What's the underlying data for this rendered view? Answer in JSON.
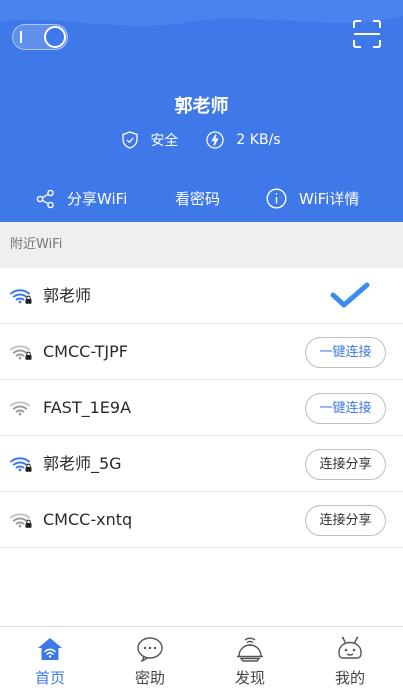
{
  "header": {
    "title": "郭老师",
    "security_label": "安全",
    "speed_label": "2 KB/s",
    "actions": {
      "share": "分享WiFi",
      "password": "看密码",
      "details": "WiFi详情"
    }
  },
  "section": {
    "label": "附近WiFi"
  },
  "networks": [
    {
      "name": "郭老师",
      "locked": true,
      "strong": true,
      "status": "connected"
    },
    {
      "name": "CMCC-TJPF",
      "locked": true,
      "strong": false,
      "button": "一键连接"
    },
    {
      "name": "FAST_1E9A",
      "locked": false,
      "strong": false,
      "button": "一键连接"
    },
    {
      "name": "郭老师_5G",
      "locked": true,
      "strong": true,
      "button": "连接分享"
    },
    {
      "name": "CMCC-xntq",
      "locked": true,
      "strong": false,
      "button": "连接分享"
    }
  ],
  "tabs": [
    {
      "label": "首页",
      "icon": "home-wifi-icon",
      "active": true
    },
    {
      "label": "密助",
      "icon": "chat-bubble-icon",
      "active": false
    },
    {
      "label": "发现",
      "icon": "discover-icon",
      "active": false
    },
    {
      "label": "我的",
      "icon": "robot-face-icon",
      "active": false
    }
  ],
  "colors": {
    "primary": "#3f78e8",
    "header_wave": "#4a82ee",
    "divider": "#e2e2e2"
  }
}
